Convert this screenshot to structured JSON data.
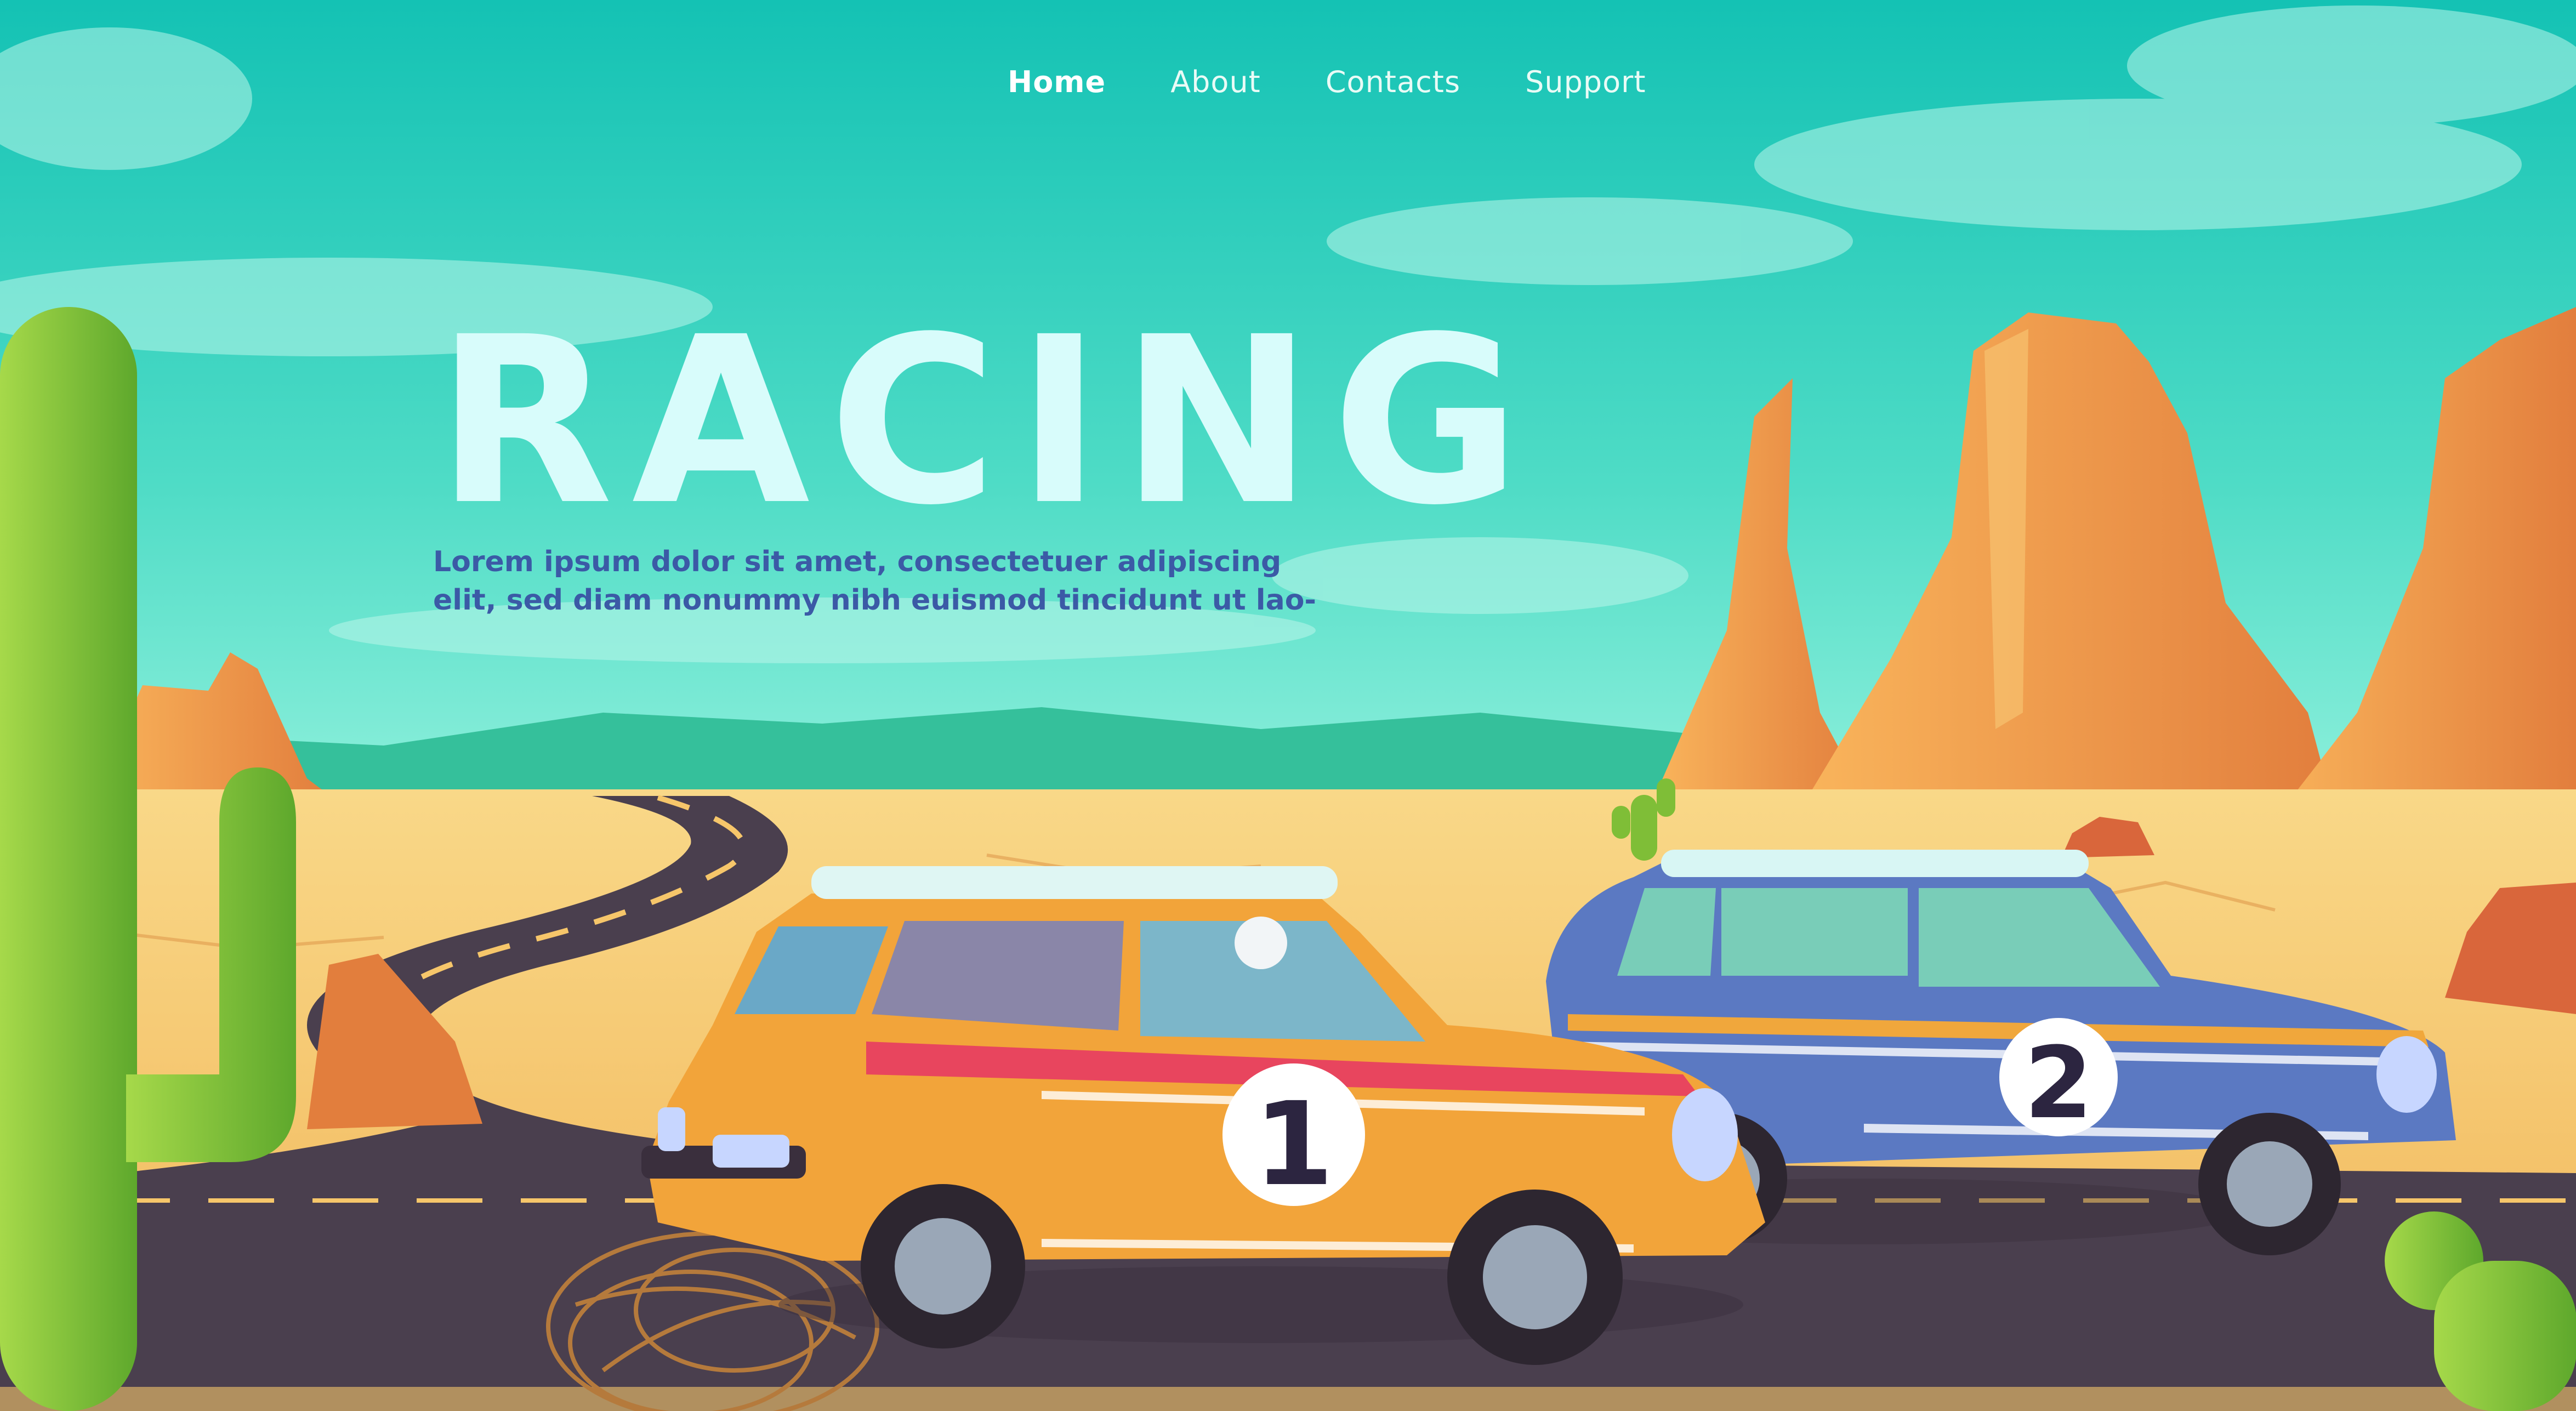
{
  "nav": {
    "items": [
      {
        "label": "Home",
        "active": true
      },
      {
        "label": "About",
        "active": false
      },
      {
        "label": "Contacts",
        "active": false
      },
      {
        "label": "Support",
        "active": false
      }
    ]
  },
  "hero": {
    "title": "RACING",
    "text_lines": [
      "Lorem ipsum dolor sit amet, consectetuer adipiscing",
      "elit, sed diam nonummy nibh euismod tincidunt ut lao-"
    ]
  },
  "cars": [
    {
      "number": "1",
      "body_color": "#f2a43a",
      "stripe_color": "#e8455e"
    },
    {
      "number": "2",
      "body_color": "#5b79c2",
      "stripe_color": "#f0a73c"
    }
  ],
  "colors": {
    "sky_top": "#14c2b4",
    "sky_bottom": "#8ff0dc",
    "sand": "#f6c66a",
    "rock": "#ee9a45",
    "road": "#4a3f4e",
    "cactus": "#86c13a",
    "headline": "#d8fcfb",
    "text_accent": "#3b5aa6"
  }
}
